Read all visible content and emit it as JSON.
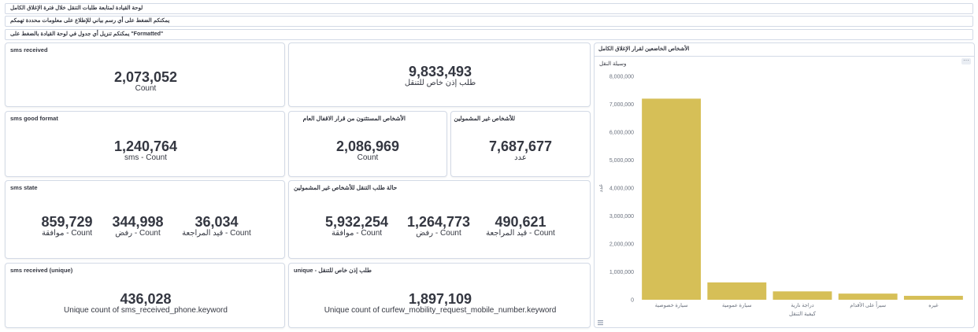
{
  "header_bars": [
    "لوحة القيادة لمتابعة طلبات التنقل خلال فترة الإغلاق الكامل",
    "يمكنكم الضغط على أي رسم بياني للإطلاع على معلومات محددة تهمكم",
    "يمكنكم تنزيل أي جدول في لوحة القيادة بالضغط على \"Formatted\""
  ],
  "panels": {
    "sms_received": {
      "title": "sms received",
      "value": "2,073,052",
      "label": "Count"
    },
    "travel_permit": {
      "title": "",
      "value": "9,833,493",
      "label": "طلب إذن خاص للتنقل"
    },
    "sms_good_format": {
      "title": "sms good format",
      "value": "1,240,764",
      "label": "sms - Count"
    },
    "exempted": {
      "title": "الأشخاص المستثنون من قرار الاقفال العام",
      "value": "2,086,969",
      "label": "Count"
    },
    "not_covered": {
      "title": "للأشخاص غير المشمولين",
      "value": "7,687,677",
      "label": "عدد"
    },
    "sms_state": {
      "title": "sms state",
      "metrics": [
        {
          "value": "859,729",
          "label": "موافقة - Count"
        },
        {
          "value": "344,998",
          "label": "رفض - Count"
        },
        {
          "value": "36,034",
          "label": "قيد المراجعة - Count"
        }
      ]
    },
    "request_state": {
      "title": "حالة طلب التنقل للأشخاص غير المشمولين",
      "metrics": [
        {
          "value": "5,932,254",
          "label": "موافقة - Count"
        },
        {
          "value": "1,264,773",
          "label": "رفض - Count"
        },
        {
          "value": "490,621",
          "label": "قيد المراجعة - Count"
        }
      ]
    },
    "sms_unique": {
      "title": "sms received (unique)",
      "value": "436,028",
      "label": "Unique count of sms_received_phone.keyword"
    },
    "request_unique": {
      "title": "unique - طلب إذن خاص للتنقل",
      "value": "1,897,109",
      "label": "Unique count of curfew_mobility_request_mobile_number.keyword"
    }
  },
  "chart_panel": {
    "header": "الأشخاص الخاضعين لقرار الإغلاق الكامل",
    "options_icon": "ellipsis-icon"
  },
  "chart_data": {
    "type": "bar",
    "title": "وسيلة النقل",
    "xlabel": "كيفية التنقل",
    "ylabel": "عدد",
    "categories": [
      "سيارة خصوصية",
      "سيارة عمومية",
      "دراجة نارية",
      "سيراً على الأقدام",
      "غيره"
    ],
    "values": [
      7200000,
      620000,
      300000,
      220000,
      140000
    ],
    "ylim": [
      0,
      8000000
    ],
    "yticks": [
      "0",
      "1,000,000",
      "2,000,000",
      "3,000,000",
      "4,000,000",
      "5,000,000",
      "6,000,000",
      "7,000,000",
      "8,000,000"
    ],
    "bar_color": "#d6bf57",
    "grid": false
  }
}
